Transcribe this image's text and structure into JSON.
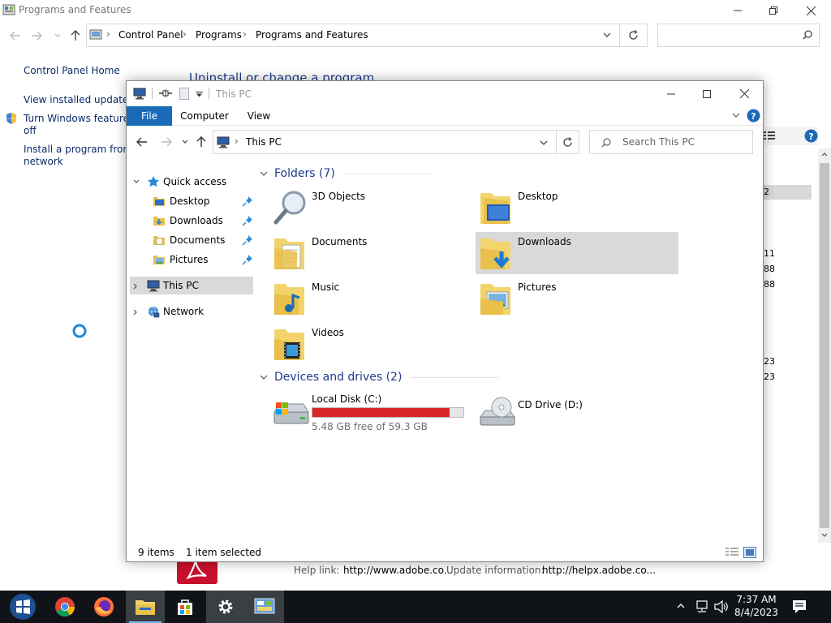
{
  "cp": {
    "title": "Programs and Features",
    "breadcrumb": [
      "Control Panel",
      "Programs",
      "Programs and Features"
    ],
    "sidebar": {
      "home": "Control Panel Home",
      "updates": "View installed updates",
      "features_line1": "Turn Windows features o",
      "features_line2": "off",
      "install_line1": "Install a program from th",
      "install_line2": "network"
    },
    "heading": "Uninstall or change a program",
    "peek_values": [
      "2",
      "11",
      "88",
      "88",
      "23",
      "23"
    ],
    "detail": {
      "help_label": "Help link:",
      "help_value": "http://www.adobe.co...",
      "update_label": "Update information:",
      "update_value": "http://helpx.adobe.co..."
    }
  },
  "explorer": {
    "title": "This PC",
    "tabs": [
      "File",
      "Computer",
      "View"
    ],
    "address": "This PC",
    "search_placeholder": "Search This PC",
    "sidebar": {
      "quick_access": "Quick access",
      "pinned": [
        "Desktop",
        "Downloads",
        "Documents",
        "Pictures"
      ],
      "this_pc": "This PC",
      "network": "Network"
    },
    "folders_header": "Folders (7)",
    "folders": [
      "3D Objects",
      "Desktop",
      "Documents",
      "Downloads",
      "Music",
      "Pictures",
      "Videos"
    ],
    "drives_header": "Devices and drives (2)",
    "drives": [
      {
        "name": "Local Disk (C:)",
        "free": "5.48 GB free of 59.3 GB",
        "used_fraction": 0.908
      },
      {
        "name": "CD Drive (D:)"
      }
    ],
    "status": {
      "items": "9 items",
      "selected": "1 item selected"
    }
  },
  "taskbar": {
    "time": "7:37 AM",
    "date": "8/4/2023"
  },
  "colors": {
    "accent": "#1a6ab8",
    "drive_bar": "#da2626",
    "selection": "#d9d9d9",
    "taskbar": "#101418"
  }
}
